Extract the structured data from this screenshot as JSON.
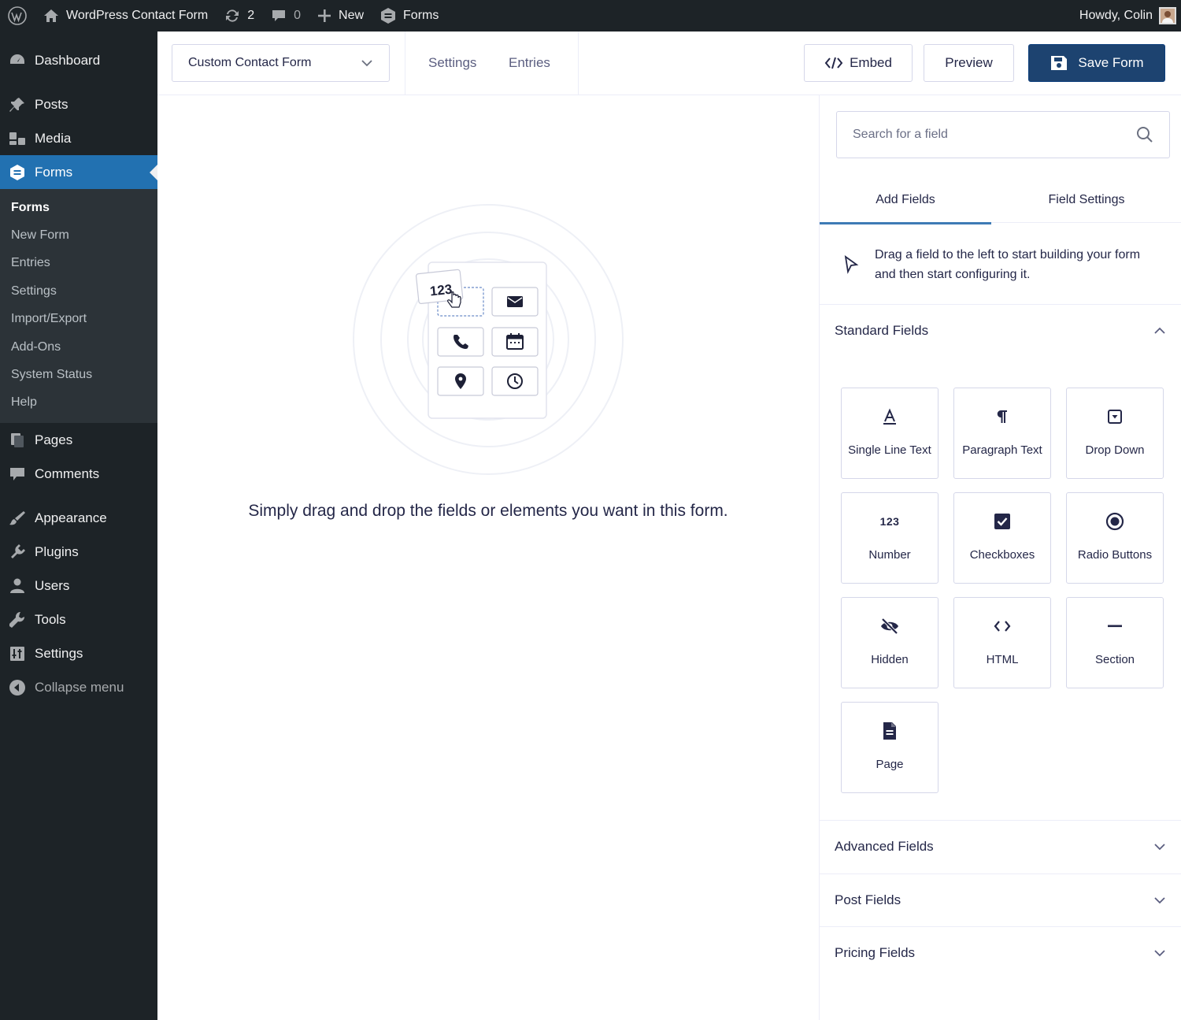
{
  "admin_bar": {
    "site_name": "WordPress Contact Form",
    "updates_count": "2",
    "comments_count": "0",
    "new_label": "New",
    "forms_label": "Forms",
    "greeting": "Howdy, Colin"
  },
  "sidebar": {
    "items_top": [
      {
        "label": "Dashboard",
        "icon": "dashboard-icon"
      },
      {
        "label": "Posts",
        "icon": "pin-icon"
      },
      {
        "label": "Media",
        "icon": "media-icon"
      },
      {
        "label": "Forms",
        "icon": "gravity-forms-icon",
        "active": true
      }
    ],
    "submenu": [
      "Forms",
      "New Form",
      "Entries",
      "Settings",
      "Import/Export",
      "Add-Ons",
      "System Status",
      "Help"
    ],
    "items_bottom": [
      {
        "label": "Pages",
        "icon": "pages-icon"
      },
      {
        "label": "Comments",
        "icon": "comment-icon"
      },
      {
        "label": "Appearance",
        "icon": "brush-icon"
      },
      {
        "label": "Plugins",
        "icon": "plugin-icon"
      },
      {
        "label": "Users",
        "icon": "user-icon"
      },
      {
        "label": "Tools",
        "icon": "wrench-icon"
      },
      {
        "label": "Settings",
        "icon": "settings-icon"
      },
      {
        "label": "Collapse menu",
        "icon": "collapse-icon"
      }
    ]
  },
  "toolbar": {
    "form_name": "Custom Contact Form",
    "settings_link": "Settings",
    "entries_link": "Entries",
    "embed_label": "Embed",
    "preview_label": "Preview",
    "save_label": "Save Form"
  },
  "canvas": {
    "illustration_badge": "123",
    "message": "Simply drag and drop the fields or elements you want in this form."
  },
  "panel": {
    "search_placeholder": "Search for a field",
    "tabs": [
      "Add Fields",
      "Field Settings"
    ],
    "hint": "Drag a field to the left to start building your form and then start configuring it.",
    "standard_title": "Standard Fields",
    "fields": [
      {
        "label": "Single Line Text",
        "icon": "text-icon"
      },
      {
        "label": "Paragraph Text",
        "icon": "paragraph-icon"
      },
      {
        "label": "Drop Down",
        "icon": "dropdown-icon"
      },
      {
        "label": "Number",
        "icon": "number-icon"
      },
      {
        "label": "Checkboxes",
        "icon": "checkbox-icon"
      },
      {
        "label": "Radio Buttons",
        "icon": "radio-icon"
      },
      {
        "label": "Hidden",
        "icon": "eye-slash-icon"
      },
      {
        "label": "HTML",
        "icon": "code-icon"
      },
      {
        "label": "Section",
        "icon": "minus-icon"
      },
      {
        "label": "Page",
        "icon": "page-icon"
      }
    ],
    "number_icon_text": "123",
    "advanced_title": "Advanced Fields",
    "post_title": "Post Fields",
    "pricing_title": "Pricing Fields"
  },
  "colors": {
    "admin_bg": "#1d2327",
    "active_menu": "#2271b1",
    "primary_button": "#1d4370",
    "tab_underline": "#3e7bb5"
  }
}
